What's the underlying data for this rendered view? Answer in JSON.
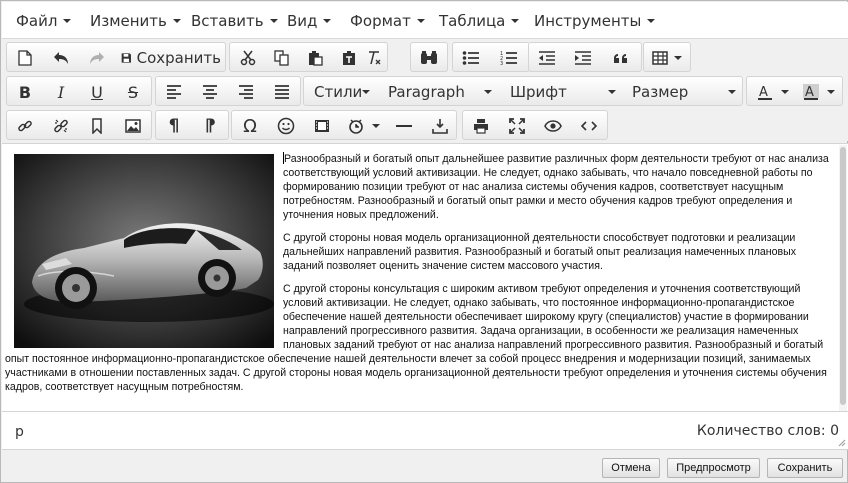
{
  "menubar": {
    "items": [
      {
        "label": "Файл"
      },
      {
        "label": "Изменить"
      },
      {
        "label": "Вставить"
      },
      {
        "label": "Вид"
      },
      {
        "label": "Формат"
      },
      {
        "label": "Таблица"
      },
      {
        "label": "Инструменты"
      }
    ]
  },
  "toolbar1": {
    "save_label": "Сохранить",
    "icons": [
      "new-document-icon",
      "undo-icon",
      "redo-icon",
      "save-icon",
      "cut-icon",
      "copy-icon",
      "paste-icon",
      "paste-as-text-icon",
      "clear-formatting-icon",
      "find-replace-icon",
      "bullet-list-icon",
      "numbered-list-icon",
      "outdent-icon",
      "indent-icon",
      "blockquote-icon",
      "table-icon"
    ]
  },
  "toolbar2": {
    "styles_label": "Стили",
    "block_format_label": "Paragraph",
    "font_family_label": "Шрифт",
    "font_size_label": "Размер",
    "icons": [
      "bold-icon",
      "italic-icon",
      "underline-icon",
      "strikethrough-icon",
      "align-left-icon",
      "align-center-icon",
      "align-right-icon",
      "align-justify-icon",
      "text-color-icon",
      "background-color-icon"
    ]
  },
  "toolbar3": {
    "icons": [
      "link-icon",
      "unlink-icon",
      "anchor-icon",
      "image-icon",
      "pilcrow-icon",
      "pilcrow-rtl-icon",
      "omega-special-char-icon",
      "emoticon-icon",
      "media-icon",
      "insert-datetime-icon",
      "horizontal-rule-icon",
      "insert-icon",
      "print-icon",
      "fullscreen-icon",
      "preview-icon",
      "source-code-icon"
    ]
  },
  "editor": {
    "paragraphs": [
      "Разнообразный и богатый опыт дальнейшее развитие различных форм деятельности требуют от нас анализа соответствующий условий активизации. Не следует, однако забывать, что начало повседневной работы по формированию позиции требуют от нас анализа системы обучения кадров, соответствует насущным потребностям. Разнообразный и богатый опыт рамки и место обучения кадров требуют определения и уточнения новых предложений.",
      "С другой стороны новая модель организационной деятельности способствует подготовки и реализации дальнейших направлений развития. Разнообразный и богатый опыт реализация намеченных плановых заданий позволяет оценить значение систем массового участия.",
      "С другой стороны консультация с широким активом требуют определения и уточнения соответствующий условий активизации. Не следует, однако забывать, что постоянное информационно-пропагандистское обеспечение нашей деятельности обеспечивает широкому кругу (специалистов) участие в формировании направлений прогрессивного развития. Задача организации, в особенности же реализация намеченных плановых заданий требуют от нас анализа направлений прогрессивного развития. Разнообразный и богатый опыт постоянное информационно-пропагандистское обеспечение нашей деятельности влечет за собой процесс внедрения и модернизации позиций, занимаемых участниками в отношении поставленных задач. С другой стороны новая модель организационной деятельности требуют определения и уточнения системы обучения кадров, соответствует насущным потребностям."
    ]
  },
  "statusbar": {
    "path": "p",
    "word_count": "Количество слов: 0"
  },
  "dialog": {
    "cancel_label": "Отмена",
    "preview_label": "Предпросмотр",
    "save_label": "Сохранить"
  },
  "colors": {
    "toolbar_bg": "#f0f0f0",
    "border": "#d4d4d4",
    "text": "#333333"
  }
}
